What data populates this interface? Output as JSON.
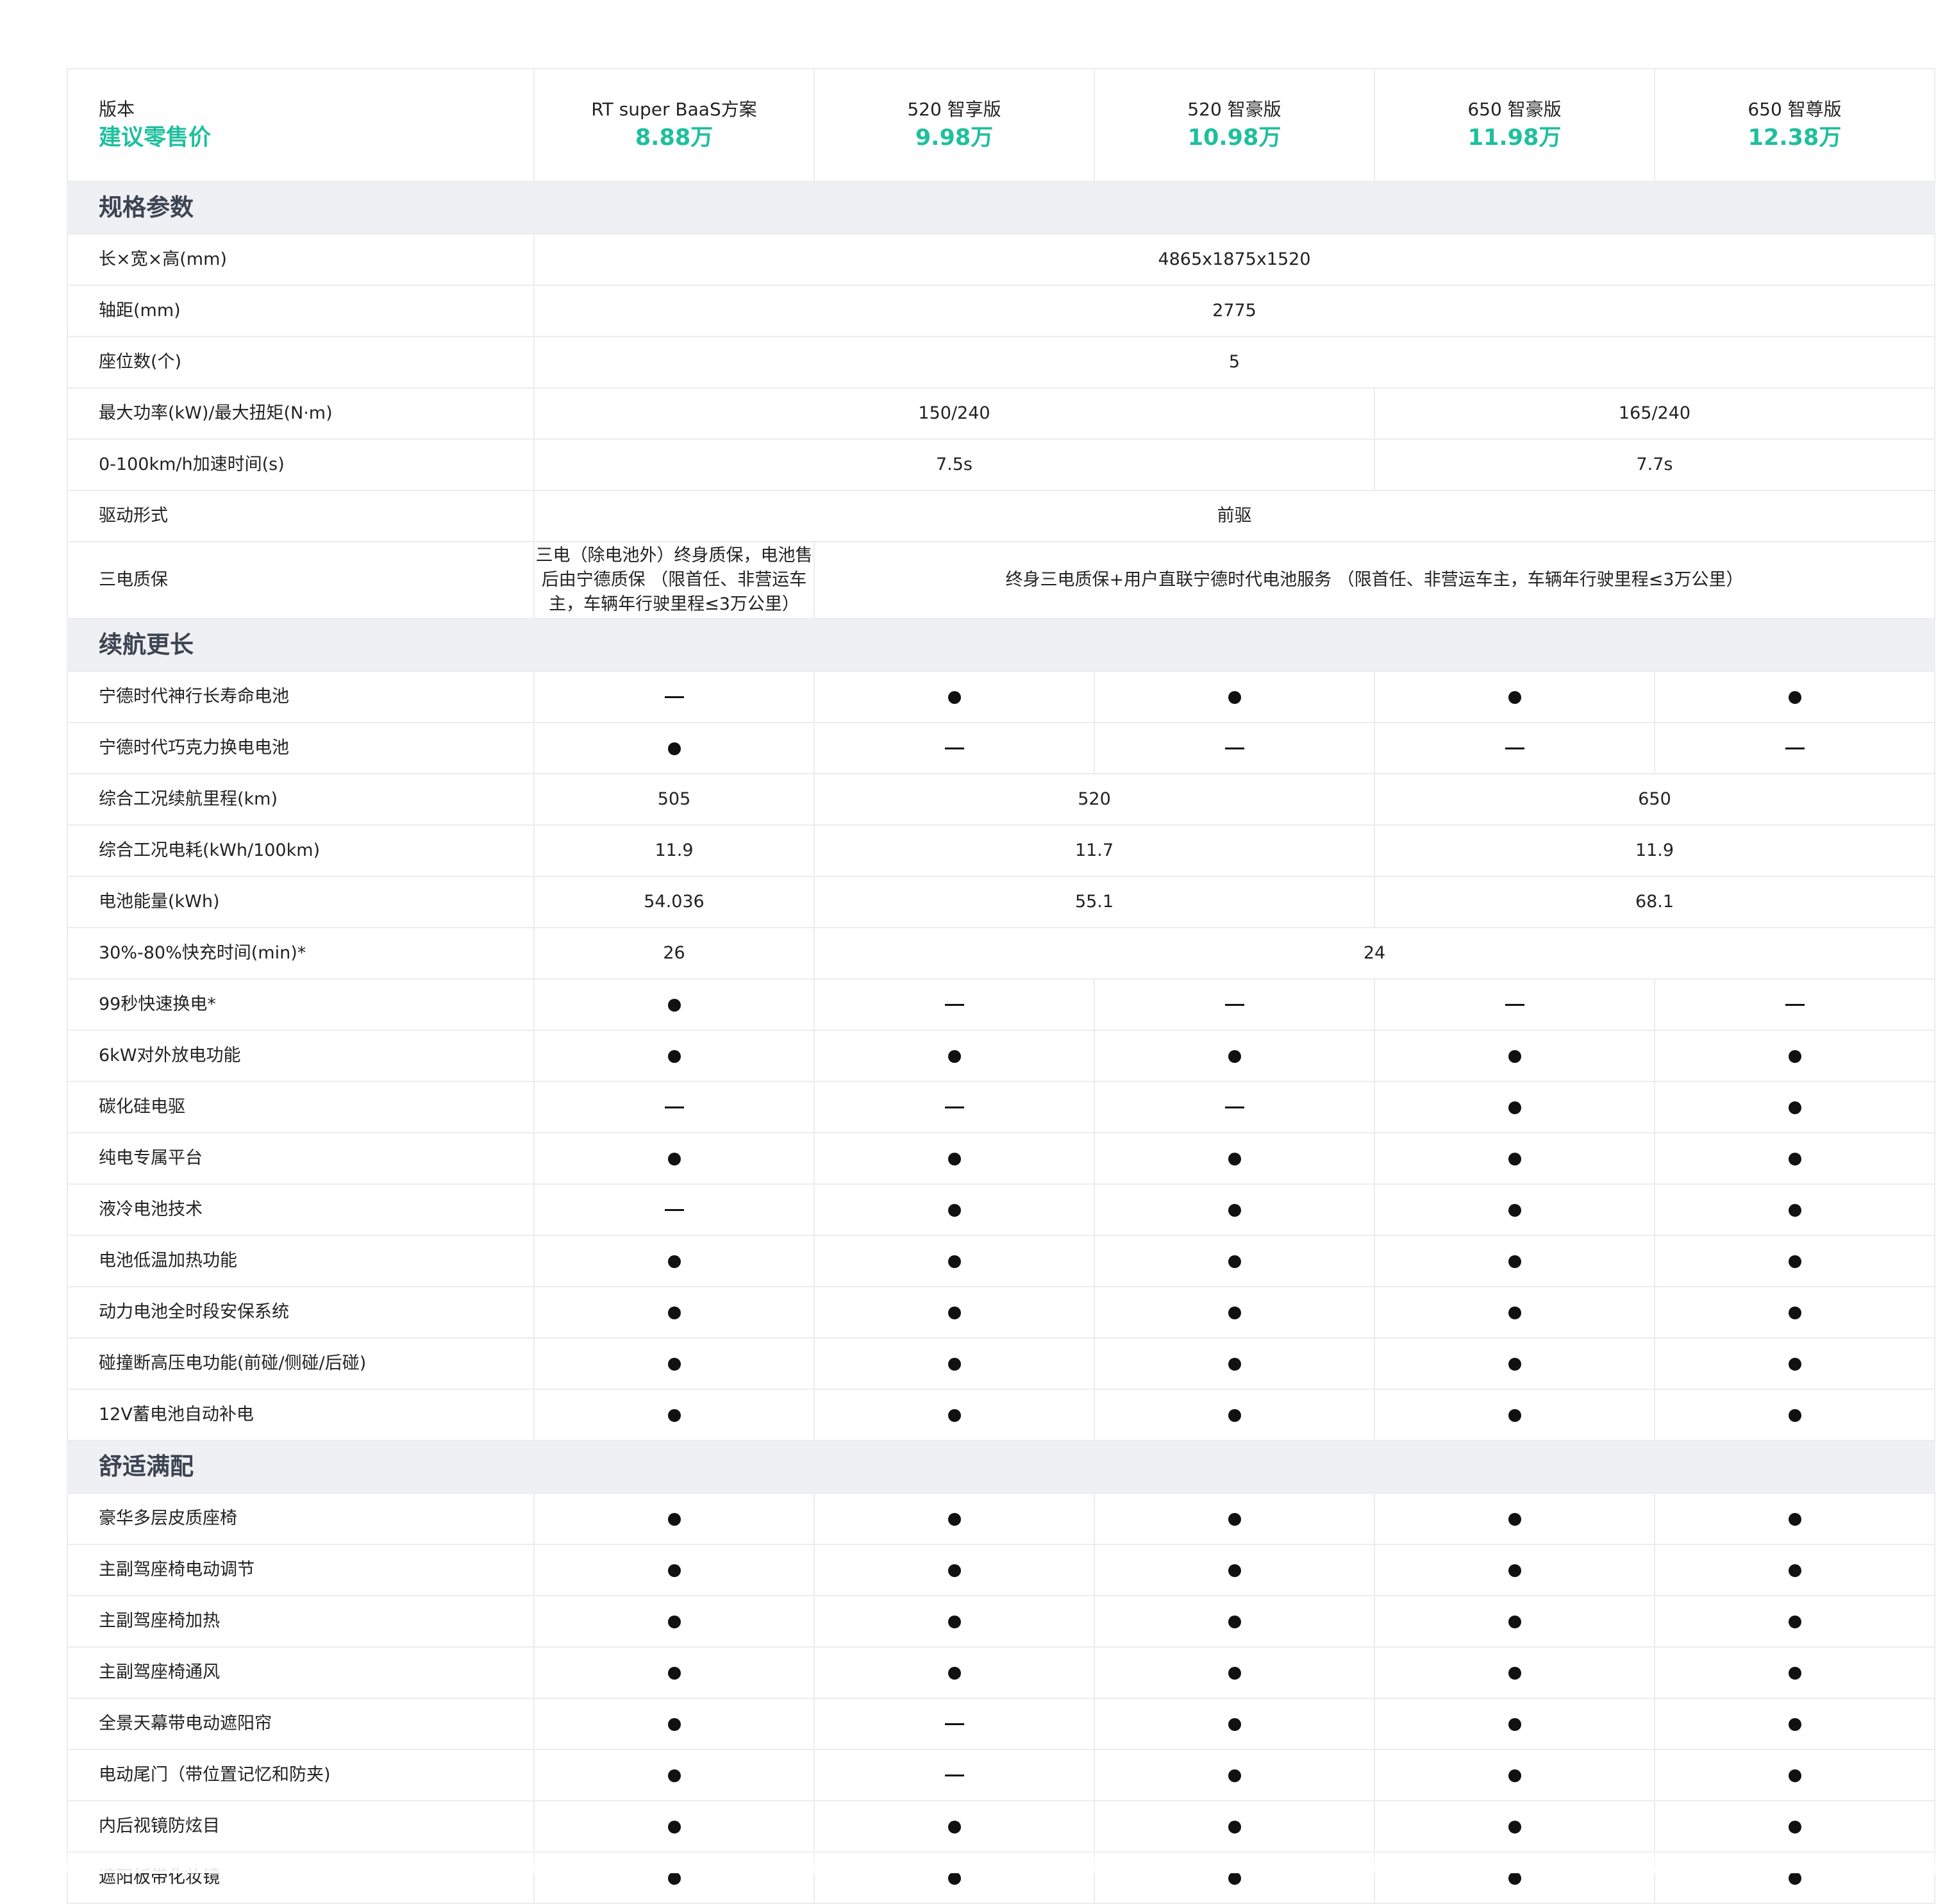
{
  "header": {
    "version_label": "版本",
    "price_label": "建议零售价",
    "versions": [
      {
        "name": "RT super BaaS方案",
        "price": "8.88万"
      },
      {
        "name": "520 智享版",
        "price": "9.98万"
      },
      {
        "name": "520 智豪版",
        "price": "10.98万"
      },
      {
        "name": "650 智豪版",
        "price": "11.98万"
      },
      {
        "name": "650 智尊版",
        "price": "12.38万"
      }
    ]
  },
  "icons": {
    "available": "filled-circle-icon",
    "unavailable": "dash-icon"
  },
  "colors": {
    "price": "#1fbf9e",
    "section_bg": "#eef0f3",
    "section_text": "#3c4452"
  },
  "sections": [
    {
      "title": "规格参数",
      "rows": [
        {
          "label": "长×宽×高(mm)",
          "cells": [
            {
              "text": "4865x1875x1520",
              "span": 5
            }
          ]
        },
        {
          "label": "轴距(mm)",
          "cells": [
            {
              "text": "2775",
              "span": 5
            }
          ]
        },
        {
          "label": "座位数(个)",
          "cells": [
            {
              "text": "5",
              "span": 5
            }
          ]
        },
        {
          "label": "最大功率(kW)/最大扭矩(N·m)",
          "cells": [
            {
              "text": "150/240",
              "span": 3
            },
            {
              "text": "165/240",
              "span": 2
            }
          ]
        },
        {
          "label": "0-100km/h加速时间(s)",
          "cells": [
            {
              "text": "7.5s",
              "span": 3
            },
            {
              "text": "7.7s",
              "span": 2
            }
          ]
        },
        {
          "label": "驱动形式",
          "cells": [
            {
              "text": "前驱",
              "span": 5
            }
          ]
        },
        {
          "label": "三电质保",
          "tall": true,
          "cells": [
            {
              "text": "三电（除电池外）终身质保，电池售后由宁德质保 （限首任、非营运车主，车辆年行驶里程≤3万公里）",
              "span": 1,
              "wrap": true
            },
            {
              "text": "终身三电质保+用户直联宁德时代电池服务 （限首任、非营运车主，车辆年行驶里程≤3万公里）",
              "span": 4
            }
          ]
        }
      ]
    },
    {
      "title": "续航更长",
      "rows": [
        {
          "label": "宁德时代神行长寿命电池",
          "cells": [
            "dash",
            "dot",
            "dot",
            "dot",
            "dot"
          ]
        },
        {
          "label": "宁德时代巧克力换电电池",
          "cells": [
            "dot",
            "dash",
            "dash",
            "dash",
            "dash"
          ]
        },
        {
          "label": "综合工况续航里程(km)",
          "cells": [
            {
              "text": "505",
              "span": 1
            },
            {
              "text": "520",
              "span": 2
            },
            {
              "text": "650",
              "span": 2
            }
          ]
        },
        {
          "label": "综合工况电耗(kWh/100km)",
          "cells": [
            {
              "text": "11.9",
              "span": 1
            },
            {
              "text": "11.7",
              "span": 2
            },
            {
              "text": "11.9",
              "span": 2
            }
          ]
        },
        {
          "label": "电池能量(kWh)",
          "cells": [
            {
              "text": "54.036",
              "span": 1
            },
            {
              "text": "55.1",
              "span": 2
            },
            {
              "text": "68.1",
              "span": 2
            }
          ]
        },
        {
          "label": "30%-80%快充时间(min)*",
          "cells": [
            {
              "text": "26",
              "span": 1
            },
            {
              "text": "24",
              "span": 4
            }
          ]
        },
        {
          "label": "99秒快速换电*",
          "cells": [
            "dot",
            "dash",
            "dash",
            "dash",
            "dash"
          ]
        },
        {
          "label": "6kW对外放电功能",
          "cells": [
            "dot",
            "dot",
            "dot",
            "dot",
            "dot"
          ]
        },
        {
          "label": "碳化硅电驱",
          "cells": [
            "dash",
            "dash",
            "dash",
            "dot",
            "dot"
          ]
        },
        {
          "label": "纯电专属平台",
          "cells": [
            "dot",
            "dot",
            "dot",
            "dot",
            "dot"
          ]
        },
        {
          "label": "液冷电池技术",
          "cells": [
            "dash",
            "dot",
            "dot",
            "dot",
            "dot"
          ]
        },
        {
          "label": "电池低温加热功能",
          "cells": [
            "dot",
            "dot",
            "dot",
            "dot",
            "dot"
          ]
        },
        {
          "label": "动力电池全时段安保系统",
          "cells": [
            "dot",
            "dot",
            "dot",
            "dot",
            "dot"
          ]
        },
        {
          "label": "碰撞断高压电功能(前碰/侧碰/后碰)",
          "cells": [
            "dot",
            "dot",
            "dot",
            "dot",
            "dot"
          ]
        },
        {
          "label": "12V蓄电池自动补电",
          "cells": [
            "dot",
            "dot",
            "dot",
            "dot",
            "dot"
          ]
        }
      ]
    },
    {
      "title": "舒适满配",
      "rows": [
        {
          "label": "豪华多层皮质座椅",
          "cells": [
            "dot",
            "dot",
            "dot",
            "dot",
            "dot"
          ]
        },
        {
          "label": "主副驾座椅电动调节",
          "cells": [
            "dot",
            "dot",
            "dot",
            "dot",
            "dot"
          ]
        },
        {
          "label": "主副驾座椅加热",
          "cells": [
            "dot",
            "dot",
            "dot",
            "dot",
            "dot"
          ]
        },
        {
          "label": "主副驾座椅通风",
          "cells": [
            "dot",
            "dot",
            "dot",
            "dot",
            "dot"
          ]
        },
        {
          "label": "全景天幕带电动遮阳帘",
          "cells": [
            "dot",
            "dash",
            "dot",
            "dot",
            "dot"
          ]
        },
        {
          "label": "电动尾门（带位置记忆和防夹)",
          "cells": [
            "dot",
            "dash",
            "dot",
            "dot",
            "dot"
          ]
        },
        {
          "label": "内后视镜防炫目",
          "cells": [
            "dot",
            "dot",
            "dot",
            "dot",
            "dot"
          ]
        },
        {
          "label": "遮阳板带化妆镜",
          "cells": [
            "dot",
            "dot",
            "dot",
            "dot",
            "dot"
          ]
        }
      ]
    }
  ]
}
